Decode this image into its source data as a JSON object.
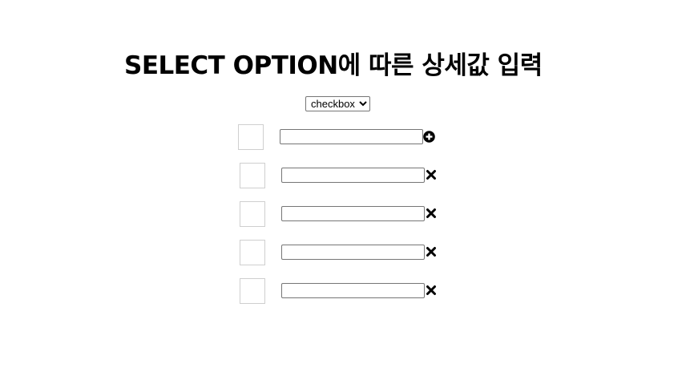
{
  "title": "SELECT OPTION에 따른 상세값 입력",
  "select": {
    "selected": "checkbox",
    "options": [
      "checkbox"
    ]
  },
  "rows": [
    {
      "value": "",
      "action_icon": "plus-circle-icon"
    },
    {
      "value": "",
      "action_icon": "close-icon"
    },
    {
      "value": "",
      "action_icon": "close-icon"
    },
    {
      "value": "",
      "action_icon": "close-icon"
    },
    {
      "value": "",
      "action_icon": "close-icon"
    }
  ]
}
